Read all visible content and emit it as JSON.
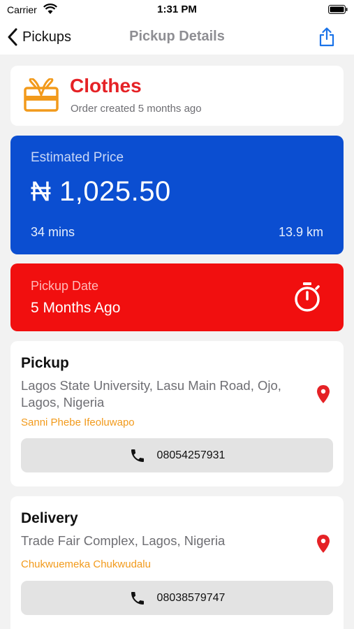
{
  "status_bar": {
    "carrier": "Carrier",
    "time": "1:31 PM"
  },
  "nav": {
    "back_label": "Pickups",
    "title": "Pickup Details"
  },
  "category": {
    "title": "Clothes",
    "subtitle": "Order created 5 months ago"
  },
  "price": {
    "label": "Estimated Price",
    "value": "₦ 1,025.50",
    "duration": "34 mins",
    "distance": "13.9 km"
  },
  "pickup_date": {
    "label": "Pickup Date",
    "value": "5 Months Ago"
  },
  "pickup": {
    "title": "Pickup",
    "address": "Lagos State University, Lasu Main Road, Ojo, Lagos, Nigeria",
    "contact": "Sanni Phebe Ifeoluwapo",
    "phone": "08054257931"
  },
  "delivery": {
    "title": "Delivery",
    "address": "Trade Fair Complex, Lagos, Nigeria",
    "contact": "Chukwuemeka Chukwudalu",
    "phone": "08038579747"
  },
  "colors": {
    "accent_blue": "#0b4ed1",
    "alert_red": "#f10f0f",
    "brand_orange": "#f29a1b",
    "title_red": "#e52226"
  },
  "icons": [
    "wifi-icon",
    "battery-icon",
    "back-chevron-icon",
    "share-icon",
    "gift-icon",
    "stopwatch-icon",
    "location-pin-icon",
    "phone-icon"
  ]
}
